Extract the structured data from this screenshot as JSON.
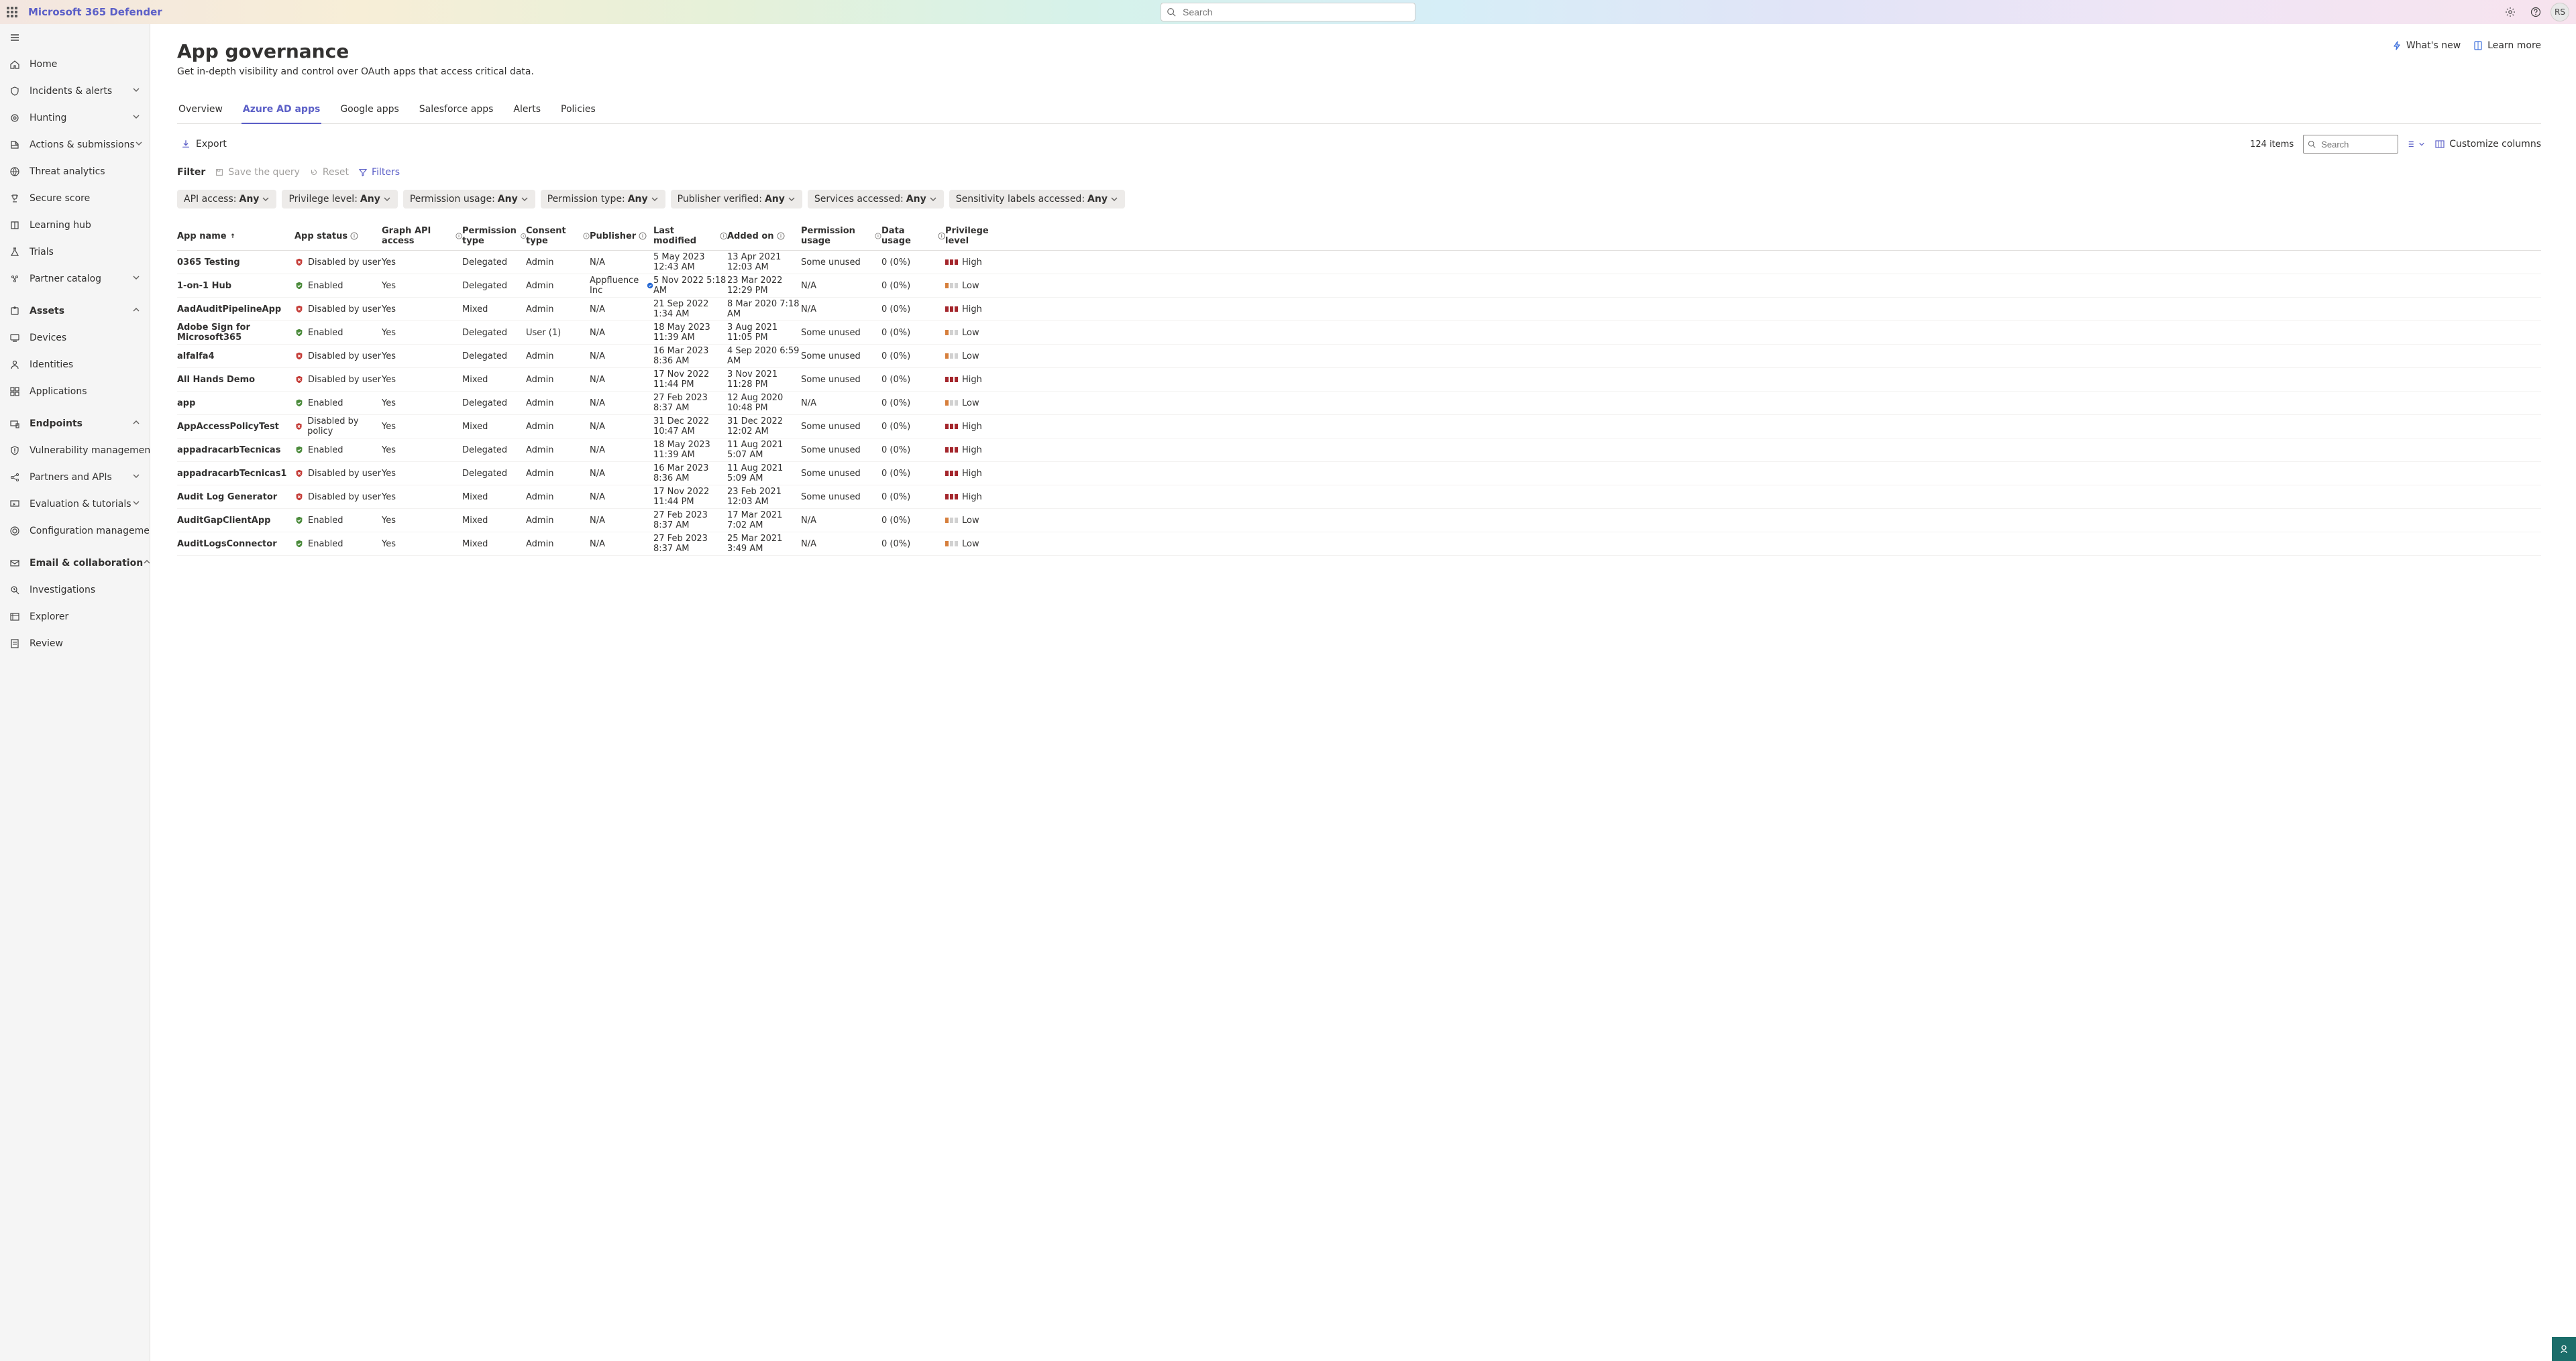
{
  "header": {
    "product": "Microsoft 365 Defender",
    "search_placeholder": "Search",
    "avatar_initials": "RS"
  },
  "sidebar": {
    "items": [
      {
        "icon": "home",
        "label": "Home"
      },
      {
        "icon": "shield-alert",
        "label": "Incidents & alerts",
        "expand": "down"
      },
      {
        "icon": "target",
        "label": "Hunting",
        "expand": "down"
      },
      {
        "icon": "inbox-actions",
        "label": "Actions & submissions",
        "expand": "down"
      },
      {
        "icon": "threat",
        "label": "Threat analytics"
      },
      {
        "icon": "trophy",
        "label": "Secure score"
      },
      {
        "icon": "book",
        "label": "Learning hub"
      },
      {
        "icon": "flask",
        "label": "Trials"
      },
      {
        "icon": "catalog",
        "label": "Partner catalog",
        "expand": "down"
      }
    ],
    "assets_group": {
      "icon": "puzzle",
      "label": "Assets",
      "expand": "up",
      "children": [
        {
          "icon": "device",
          "label": "Devices"
        },
        {
          "icon": "identity",
          "label": "Identities"
        },
        {
          "icon": "apps",
          "label": "Applications"
        }
      ]
    },
    "endpoints_group": {
      "icon": "endpoint",
      "label": "Endpoints",
      "expand": "up",
      "children": [
        {
          "icon": "vuln",
          "label": "Vulnerability management",
          "expand": "down"
        },
        {
          "icon": "api",
          "label": "Partners and APIs",
          "expand": "down"
        },
        {
          "icon": "eval",
          "label": "Evaluation & tutorials",
          "expand": "down"
        },
        {
          "icon": "config",
          "label": "Configuration management"
        }
      ]
    },
    "email_group": {
      "icon": "mail",
      "label": "Email & collaboration",
      "expand": "up",
      "children": [
        {
          "icon": "investigate",
          "label": "Investigations"
        },
        {
          "icon": "explorer",
          "label": "Explorer"
        },
        {
          "icon": "review",
          "label": "Review"
        }
      ]
    }
  },
  "page": {
    "title": "App governance",
    "subtitle": "Get in-depth visibility and control over OAuth apps that access critical data.",
    "whats_new": "What's new",
    "learn_more": "Learn more"
  },
  "tabs": [
    {
      "label": "Overview"
    },
    {
      "label": "Azure AD apps",
      "active": true
    },
    {
      "label": "Google apps"
    },
    {
      "label": "Salesforce apps"
    },
    {
      "label": "Alerts"
    },
    {
      "label": "Policies"
    }
  ],
  "toolbar": {
    "export": "Export",
    "item_count": "124 items",
    "mini_search_placeholder": "Search",
    "customize_columns": "Customize columns"
  },
  "filterbar": {
    "label": "Filter",
    "save_query": "Save the query",
    "reset": "Reset",
    "filters": "Filters"
  },
  "pills": [
    {
      "label": "API access:",
      "value": "Any"
    },
    {
      "label": "Privilege level:",
      "value": "Any"
    },
    {
      "label": "Permission usage:",
      "value": "Any"
    },
    {
      "label": "Permission type:",
      "value": "Any"
    },
    {
      "label": "Publisher verified:",
      "value": "Any"
    },
    {
      "label": "Services accessed:",
      "value": "Any"
    },
    {
      "label": "Sensitivity labels accessed:",
      "value": "Any"
    }
  ],
  "columns": [
    {
      "label": "App name",
      "sort": true
    },
    {
      "label": "App status",
      "info": true
    },
    {
      "label": "Graph API access",
      "info": true
    },
    {
      "label": "Permission type",
      "info": true
    },
    {
      "label": "Consent type",
      "info": true
    },
    {
      "label": "Publisher",
      "info": true
    },
    {
      "label": "Last modified",
      "info": true
    },
    {
      "label": "Added on",
      "info": true
    },
    {
      "label": "Permission usage",
      "info": true
    },
    {
      "label": "Data usage",
      "info": true
    },
    {
      "label": "Privilege level"
    }
  ],
  "rows": [
    {
      "app": "0365 Testing",
      "status": "Disabled by user",
      "statusIcon": "disabled",
      "graph": "Yes",
      "perm": "Delegated",
      "consent": "Admin",
      "publisher": "N/A",
      "verified": false,
      "modified": "5 May 2023 12:43 AM",
      "added": "13 Apr 2021 12:03 AM",
      "usage": "Some unused",
      "data": "0 (0%)",
      "priv": "High"
    },
    {
      "app": "1-on-1 Hub",
      "status": "Enabled",
      "statusIcon": "enabled",
      "graph": "Yes",
      "perm": "Delegated",
      "consent": "Admin",
      "publisher": "Appfluence Inc",
      "verified": true,
      "modified": "5 Nov 2022 5:18 AM",
      "added": "23 Mar 2022 12:29 PM",
      "usage": "N/A",
      "data": "0 (0%)",
      "priv": "Low"
    },
    {
      "app": "AadAuditPipelineApp",
      "status": "Disabled by user",
      "statusIcon": "disabled",
      "graph": "Yes",
      "perm": "Mixed",
      "consent": "Admin",
      "publisher": "N/A",
      "verified": false,
      "modified": "21 Sep 2022 1:34 AM",
      "added": "8 Mar 2020 7:18 AM",
      "usage": "N/A",
      "data": "0 (0%)",
      "priv": "High"
    },
    {
      "app": "Adobe Sign for Microsoft365",
      "status": "Enabled",
      "statusIcon": "enabled",
      "graph": "Yes",
      "perm": "Delegated",
      "consent": "User (1)",
      "publisher": "N/A",
      "verified": false,
      "modified": "18 May 2023 11:39 AM",
      "added": "3 Aug 2021 11:05 PM",
      "usage": "Some unused",
      "data": "0 (0%)",
      "priv": "Low"
    },
    {
      "app": "alfalfa4",
      "status": "Disabled by user",
      "statusIcon": "disabled",
      "graph": "Yes",
      "perm": "Delegated",
      "consent": "Admin",
      "publisher": "N/A",
      "verified": false,
      "modified": "16 Mar 2023 8:36 AM",
      "added": "4 Sep 2020 6:59 AM",
      "usage": "Some unused",
      "data": "0 (0%)",
      "priv": "Low"
    },
    {
      "app": "All Hands Demo",
      "status": "Disabled by user",
      "statusIcon": "disabled",
      "graph": "Yes",
      "perm": "Mixed",
      "consent": "Admin",
      "publisher": "N/A",
      "verified": false,
      "modified": "17 Nov 2022 11:44 PM",
      "added": "3 Nov 2021 11:28 PM",
      "usage": "Some unused",
      "data": "0 (0%)",
      "priv": "High"
    },
    {
      "app": "app",
      "status": "Enabled",
      "statusIcon": "enabled",
      "graph": "Yes",
      "perm": "Delegated",
      "consent": "Admin",
      "publisher": "N/A",
      "verified": false,
      "modified": "27 Feb 2023 8:37 AM",
      "added": "12 Aug 2020 10:48 PM",
      "usage": "N/A",
      "data": "0 (0%)",
      "priv": "Low"
    },
    {
      "app": "AppAccessPolicyTest",
      "status": "Disabled by policy",
      "statusIcon": "disabled",
      "graph": "Yes",
      "perm": "Mixed",
      "consent": "Admin",
      "publisher": "N/A",
      "verified": false,
      "modified": "31 Dec 2022 10:47 AM",
      "added": "31 Dec 2022 12:02 AM",
      "usage": "Some unused",
      "data": "0 (0%)",
      "priv": "High"
    },
    {
      "app": "appadracarbTecnicas",
      "status": "Enabled",
      "statusIcon": "enabled",
      "graph": "Yes",
      "perm": "Delegated",
      "consent": "Admin",
      "publisher": "N/A",
      "verified": false,
      "modified": "18 May 2023 11:39 AM",
      "added": "11 Aug 2021 5:07 AM",
      "usage": "Some unused",
      "data": "0 (0%)",
      "priv": "High"
    },
    {
      "app": "appadracarbTecnicas1",
      "status": "Disabled by user",
      "statusIcon": "disabled",
      "graph": "Yes",
      "perm": "Delegated",
      "consent": "Admin",
      "publisher": "N/A",
      "verified": false,
      "modified": "16 Mar 2023 8:36 AM",
      "added": "11 Aug 2021 5:09 AM",
      "usage": "Some unused",
      "data": "0 (0%)",
      "priv": "High"
    },
    {
      "app": "Audit Log Generator",
      "status": "Disabled by user",
      "statusIcon": "disabled",
      "graph": "Yes",
      "perm": "Mixed",
      "consent": "Admin",
      "publisher": "N/A",
      "verified": false,
      "modified": "17 Nov 2022 11:44 PM",
      "added": "23 Feb 2021 12:03 AM",
      "usage": "Some unused",
      "data": "0 (0%)",
      "priv": "High"
    },
    {
      "app": "AuditGapClientApp",
      "status": "Enabled",
      "statusIcon": "enabled",
      "graph": "Yes",
      "perm": "Mixed",
      "consent": "Admin",
      "publisher": "N/A",
      "verified": false,
      "modified": "27 Feb 2023 8:37 AM",
      "added": "17 Mar 2021 7:02 AM",
      "usage": "N/A",
      "data": "0 (0%)",
      "priv": "Low"
    },
    {
      "app": "AuditLogsConnector",
      "status": "Enabled",
      "statusIcon": "enabled",
      "graph": "Yes",
      "perm": "Mixed",
      "consent": "Admin",
      "publisher": "N/A",
      "verified": false,
      "modified": "27 Feb 2023 8:37 AM",
      "added": "25 Mar 2021 3:49 AM",
      "usage": "N/A",
      "data": "0 (0%)",
      "priv": "Low"
    }
  ]
}
